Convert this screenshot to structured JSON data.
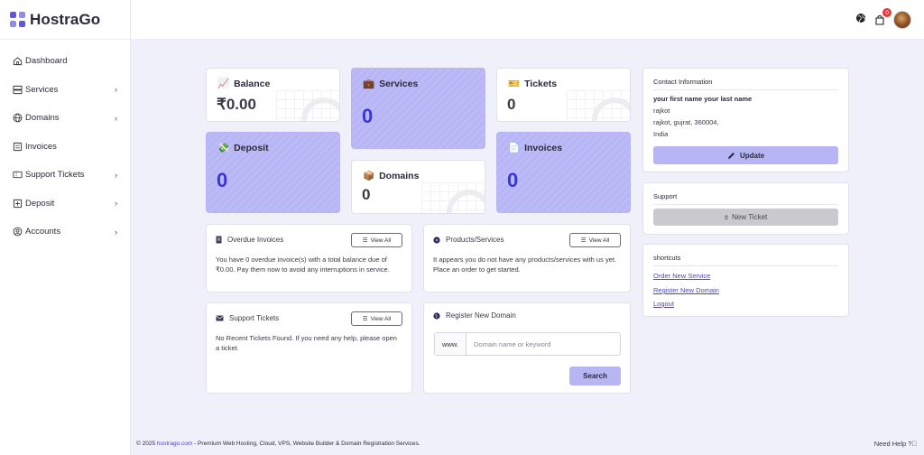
{
  "brand": {
    "name": "HostraGo"
  },
  "nav": [
    {
      "label": "Dashboard",
      "icon": "home-icon",
      "chevron": false
    },
    {
      "label": "Services",
      "icon": "server-icon",
      "chevron": true
    },
    {
      "label": "Domains",
      "icon": "globe-icon",
      "chevron": true
    },
    {
      "label": "Invoices",
      "icon": "invoice-icon",
      "chevron": false
    },
    {
      "label": "Support Tickets",
      "icon": "ticket-icon",
      "chevron": true
    },
    {
      "label": "Deposit",
      "icon": "deposit-icon",
      "chevron": true
    },
    {
      "label": "Accounts",
      "icon": "account-icon",
      "chevron": true
    }
  ],
  "topbar": {
    "cart_count": "0"
  },
  "stats": {
    "balance": {
      "title": "Balance",
      "value": "₹0.00"
    },
    "services": {
      "title": "Services",
      "value": "0"
    },
    "tickets": {
      "title": "Tickets",
      "value": "0"
    },
    "deposit": {
      "title": "Deposit",
      "value": "0"
    },
    "domains": {
      "title": "Domains",
      "value": "0"
    },
    "invoices": {
      "title": "Invoices",
      "value": "0"
    }
  },
  "panels": {
    "overdue": {
      "title": "Overdue Invoices",
      "button": "View All",
      "body": "You have 0 overdue invoice(s) with a total balance due of ₹0.00. Pay them now to avoid any interruptions in service."
    },
    "products": {
      "title": "Products/Services",
      "button": "View All",
      "body": "It appears you do not have any products/services with us yet. Place an order to get started."
    },
    "support": {
      "title": "Support Tickets",
      "button": "View All",
      "body": "No Recent Tickets Found. If you need any help, please open a ticket."
    },
    "register": {
      "title": "Register New Domain",
      "prefix": "www.",
      "placeholder": "Domain name or keyword",
      "button": "Search"
    }
  },
  "contact": {
    "title": "Contact Information",
    "name": "your first name your last name",
    "lines": [
      "rajkot",
      "rajkot, gujrat, 360004,",
      "India"
    ],
    "button": "Update"
  },
  "support_box": {
    "title": "Support",
    "button": "New Ticket"
  },
  "shortcuts": {
    "title": "shortcuts",
    "links": [
      "Order New Service",
      "Register New Domain",
      "Logout"
    ]
  },
  "footer": {
    "prefix": "© 2025 ",
    "link": "hostrago.com",
    "text": " - Premium Web Hosting, Cloud, VPS, Website Builder & Domain Registration Services.",
    "help": "Need Help"
  },
  "colors": {
    "accent": "#5b56e8",
    "tile": "#b7b5f4",
    "value_blue": "#3a35d8",
    "link": "#4a45c8"
  }
}
